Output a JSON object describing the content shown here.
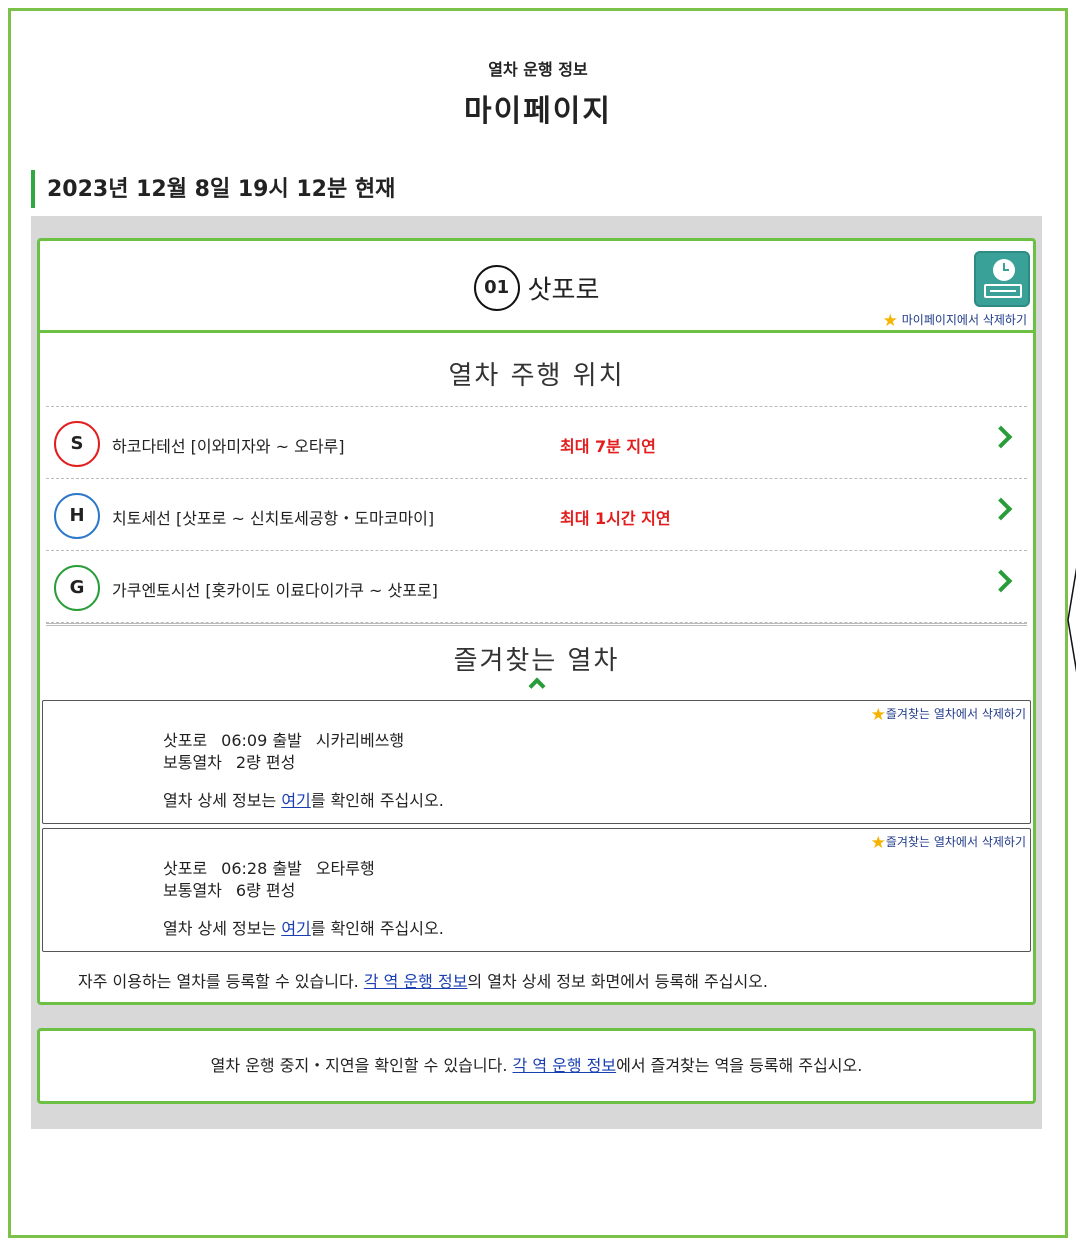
{
  "header": {
    "subtitle": "열차 운행 정보",
    "title": "마이페이지"
  },
  "as_of": "2023년 12월 8일 19시 12분 현재",
  "station": {
    "number": "01",
    "name": "삿포로",
    "remove_label": "마이페이지에서 삭제하기",
    "clock_icon": "station-clock-board-icon",
    "accent_color": "#3aa198"
  },
  "train_position": {
    "title": "열차 주행 위치",
    "lines": [
      {
        "code": "S",
        "name": "하코다테선 [이와미자와 ~ 오타루]",
        "delay": "최대 7분 지연",
        "color": "#e31d1d"
      },
      {
        "code": "H",
        "name": "치토세선 [삿포로 ~ 신치토세공항・도마코마이]",
        "delay": "최대 1시간 지연",
        "color": "#2b78c8"
      },
      {
        "code": "G",
        "name": "가쿠엔토시선 [홋카이도 이료다이가쿠 ~ 삿포로]",
        "delay": "",
        "color": "#2a9d3b"
      }
    ]
  },
  "favorites": {
    "title": "즐겨찾는 열차",
    "remove_label": "즐겨찾는 열차에서 삭제하기",
    "items": [
      {
        "station": "삿포로",
        "time": "06:09 출발",
        "dest": "시카리베쓰행",
        "type": "보통열차",
        "cars": "2량 편성",
        "detail_pre": "열차 상세 정보는 ",
        "detail_link": "여기",
        "detail_post": "를 확인해 주십시오."
      },
      {
        "station": "삿포로",
        "time": "06:28 출발",
        "dest": "오타루행",
        "type": "보통열차",
        "cars": "6량 편성",
        "detail_pre": "열차 상세 정보는 ",
        "detail_link": "여기",
        "detail_post": "를 확인해 주십시오."
      }
    ],
    "note_pre": "자주 이용하는 열차를 등록할 수 있습니다. ",
    "note_link": "각 역 운행 정보",
    "note_post": "의 열차 상세 정보 화면에서 등록해 주십시오."
  },
  "bottom_notice": {
    "pre": "열차 운행 중지・지연을 확인할 수 있습니다. ",
    "link": "각 역 운행 정보",
    "post": "에서 즐겨찾는 역을 등록해 주십시오."
  },
  "colors": {
    "frame": "#7cc24a",
    "card_border": "#6cc043",
    "delay": "#e31d1d",
    "chevron": "#2a9d3b"
  }
}
